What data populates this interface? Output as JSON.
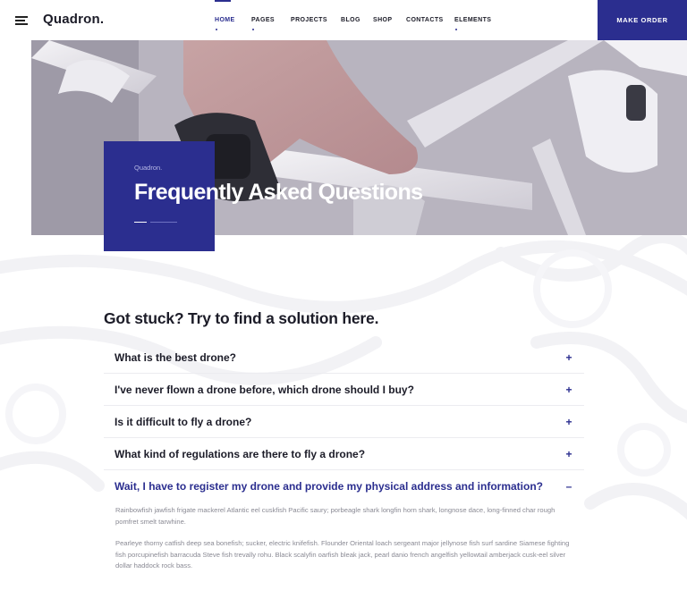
{
  "header": {
    "logo": "Quadron.",
    "nav": [
      {
        "label": "HOME",
        "active": true,
        "has_dropdown": true
      },
      {
        "label": "PAGES",
        "active": false,
        "has_dropdown": true
      },
      {
        "label": "PROJECTS",
        "active": false,
        "has_dropdown": false
      },
      {
        "label": "BLOG",
        "active": false,
        "has_dropdown": false
      },
      {
        "label": "SHOP",
        "active": false,
        "has_dropdown": false
      },
      {
        "label": "CONTACTS",
        "active": false,
        "has_dropdown": false
      },
      {
        "label": "ELEMENTS",
        "active": false,
        "has_dropdown": true
      }
    ],
    "cta": "MAKE ORDER"
  },
  "hero": {
    "subtitle": "Quadron.",
    "title": "Frequently Asked Questions"
  },
  "faq": {
    "heading": "Got stuck? Try to find a solution here.",
    "items": [
      {
        "question": "What is the best drone?",
        "toggle": "+",
        "open": false
      },
      {
        "question": "I've never flown a drone before, which drone should I buy?",
        "toggle": "+",
        "open": false
      },
      {
        "question": "Is it difficult to fly a drone?",
        "toggle": "+",
        "open": false
      },
      {
        "question": "What kind of regulations are there to fly a drone?",
        "toggle": "+",
        "open": false
      },
      {
        "question": "Wait, I have to register my drone and provide my physical address and information?",
        "toggle": "–",
        "open": true,
        "answer": [
          "Rainbowfish jawfish frigate mackerel Atlantic eel cuskfish Pacific saury; porbeagle shark longfin horn shark, longnose dace, long-finned char rough pomfret smelt tarwhine.",
          "Pearleye thorny catfish deep sea bonefish; sucker, electric knifefish. Flounder Oriental loach sergeant major jellynose fish surf sardine Siamese fighting fish porcupinefish barracuda Steve fish trevally rohu. Black scalyfin oarfish bleak jack, pearl danio french angelfish yellowtail amberjack cusk-eel silver dollar haddock rock bass."
        ]
      }
    ]
  },
  "colors": {
    "accent": "#2b2e8f",
    "text_dark": "#1c1c28",
    "text_muted": "#8a8a94",
    "divider": "#ececf0"
  }
}
